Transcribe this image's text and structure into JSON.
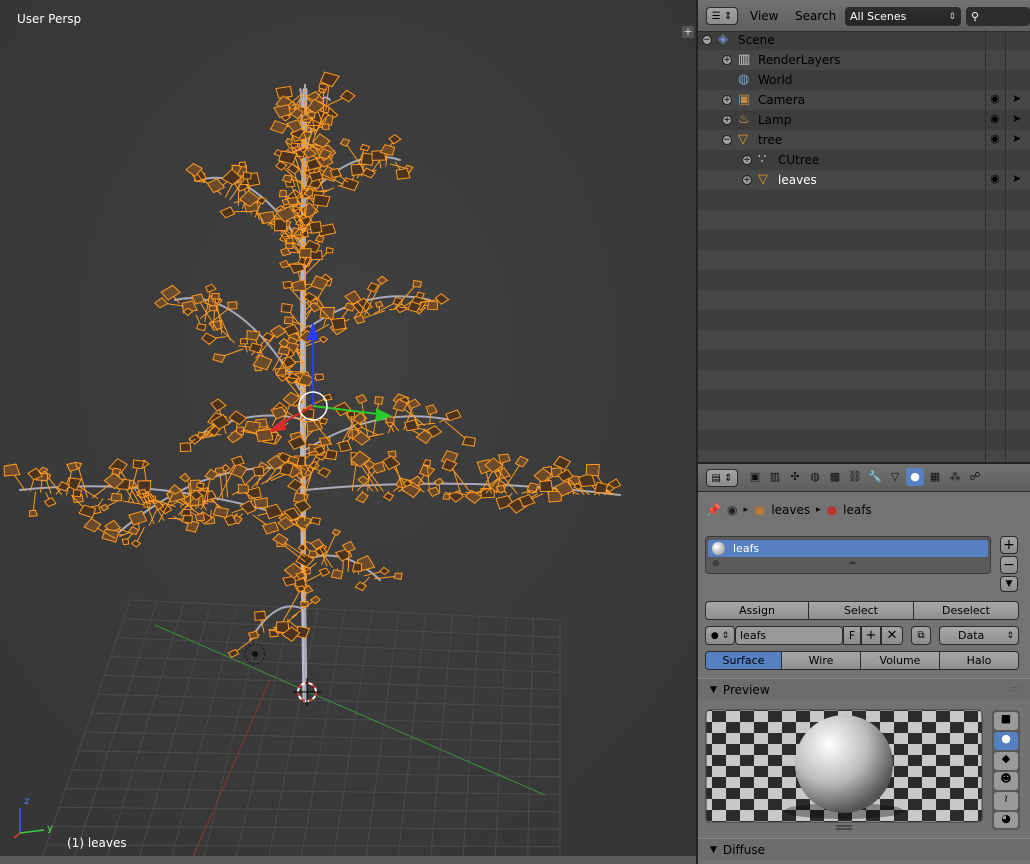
{
  "viewport": {
    "label": "User Persp",
    "object_label": "(1) leaves",
    "axis_z": "z",
    "axis_y": "y"
  },
  "outliner": {
    "view_menu": "View",
    "search_menu": "Search",
    "scene_select": "All Scenes",
    "items": [
      {
        "label": "Scene",
        "icon": "scene-icon",
        "visible": false
      },
      {
        "label": "RenderLayers",
        "icon": "render-layers-icon",
        "visible": false
      },
      {
        "label": "World",
        "icon": "world-icon",
        "visible": false
      },
      {
        "label": "Camera",
        "icon": "camera-icon",
        "visible": true
      },
      {
        "label": "Lamp",
        "icon": "lamp-icon",
        "visible": true
      },
      {
        "label": "tree",
        "icon": "mesh-icon",
        "visible": true
      },
      {
        "label": "CUtree",
        "icon": "curve-icon",
        "visible": false
      },
      {
        "label": "leaves",
        "icon": "mesh-icon",
        "visible": true
      }
    ]
  },
  "properties": {
    "breadcrumb_object": "leaves",
    "breadcrumb_material": "leafs",
    "material_slot": "leafs",
    "assign": "Assign",
    "select": "Select",
    "deselect": "Deselect",
    "material_name": "leafs",
    "fake_user": "F",
    "link_select": "Data",
    "tabs": {
      "surface": "Surface",
      "wire": "Wire",
      "volume": "Volume",
      "halo": "Halo"
    },
    "preview_title": "Preview",
    "diffuse_title": "Diffuse",
    "accent": "#5680c2",
    "active_tab_color": "#5680c2"
  }
}
